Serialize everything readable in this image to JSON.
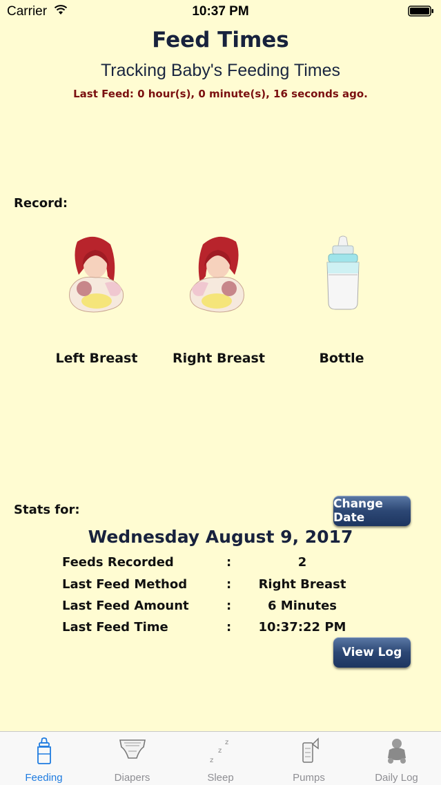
{
  "status_bar": {
    "carrier": "Carrier",
    "time": "10:37 PM"
  },
  "header": {
    "title": "Feed Times",
    "subtitle": "Tracking Baby's Feeding Times",
    "last_feed": "Last Feed: 0 hour(s), 0 minute(s), 16 seconds ago."
  },
  "record": {
    "label": "Record:",
    "options": [
      {
        "label": "Left Breast",
        "icon": "mother-nursing-left-icon"
      },
      {
        "label": "Right Breast",
        "icon": "mother-nursing-right-icon"
      },
      {
        "label": "Bottle",
        "icon": "baby-bottle-icon"
      }
    ]
  },
  "stats": {
    "label": "Stats for:",
    "change_date_label": "Change Date",
    "date": "Wednesday August 9, 2017",
    "rows": [
      {
        "key": "Feeds Recorded",
        "sep": ":",
        "value": "2"
      },
      {
        "key": "Last Feed Method",
        "sep": ":",
        "value": "Right Breast"
      },
      {
        "key": "Last Feed Amount",
        "sep": ":",
        "value": "6 Minutes"
      },
      {
        "key": "Last Feed Time",
        "sep": ":",
        "value": "10:37:22 PM"
      }
    ],
    "view_log_label": "View Log"
  },
  "tabbar": {
    "tabs": [
      {
        "label": "Feeding",
        "icon": "bottle-icon",
        "active": true
      },
      {
        "label": "Diapers",
        "icon": "diaper-icon",
        "active": false
      },
      {
        "label": "Sleep",
        "icon": "sleep-zzz-icon",
        "active": false
      },
      {
        "label": "Pumps",
        "icon": "breast-pump-icon",
        "active": false
      },
      {
        "label": "Daily Log",
        "icon": "baby-icon",
        "active": false
      }
    ]
  },
  "colors": {
    "background": "#FFFCD2",
    "title": "#18223D",
    "last_feed": "#7A1010",
    "button": "#2C4774",
    "tab_active": "#1E7BE0",
    "tab_inactive": "#8E8E93"
  }
}
